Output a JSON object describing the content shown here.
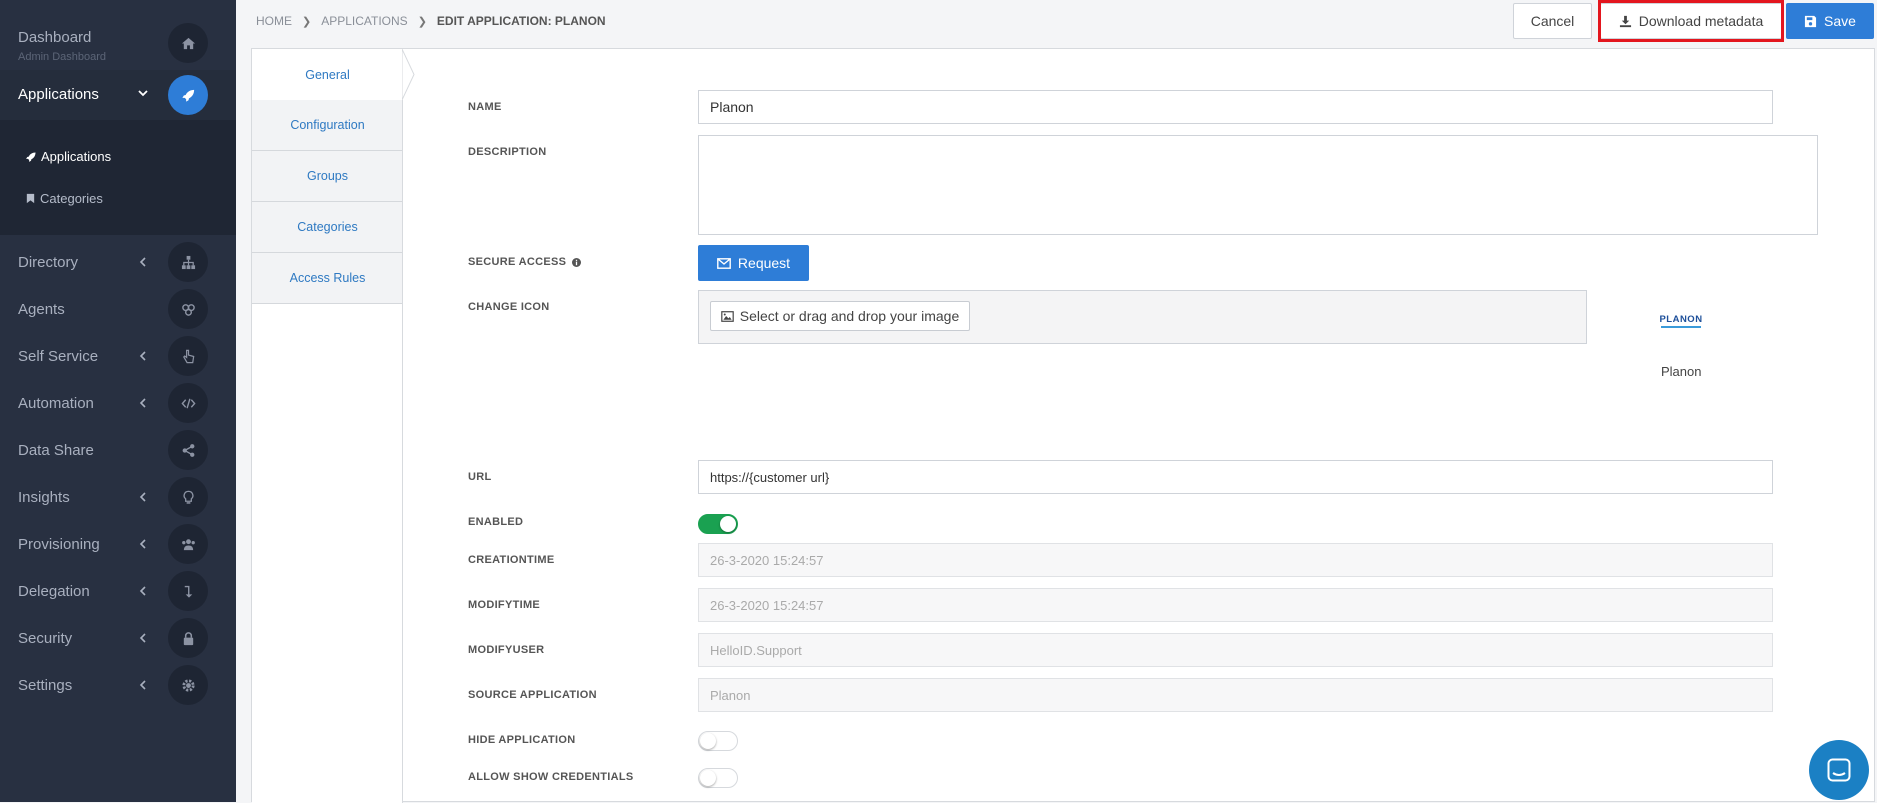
{
  "sidebar": {
    "dashboard": {
      "label": "Dashboard",
      "sub": "Admin Dashboard",
      "icon": "home-icon"
    },
    "applications": {
      "label": "Applications",
      "icon": "rocket-icon",
      "items": [
        {
          "label": "Applications",
          "icon": "rocket-icon"
        },
        {
          "label": "Categories",
          "icon": "bookmark-icon"
        }
      ]
    },
    "items": [
      {
        "label": "Directory",
        "chevron": true,
        "icon": "sitemap-icon"
      },
      {
        "label": "Agents",
        "chevron": false,
        "icon": "agents-icon"
      },
      {
        "label": "Self Service",
        "chevron": true,
        "icon": "hand-pointer-icon"
      },
      {
        "label": "Automation",
        "chevron": true,
        "icon": "code-icon"
      },
      {
        "label": "Data Share",
        "chevron": false,
        "icon": "share-icon"
      },
      {
        "label": "Insights",
        "chevron": true,
        "icon": "lightbulb-icon"
      },
      {
        "label": "Provisioning",
        "chevron": true,
        "icon": "users-icon"
      },
      {
        "label": "Delegation",
        "chevron": true,
        "icon": "delegation-icon"
      },
      {
        "label": "Security",
        "chevron": true,
        "icon": "lock-icon"
      },
      {
        "label": "Settings",
        "chevron": true,
        "icon": "gear-icon"
      }
    ]
  },
  "breadcrumb": [
    "HOME",
    "APPLICATIONS",
    "EDIT APPLICATION: PLANON"
  ],
  "buttons": {
    "cancel": "Cancel",
    "download": "Download metadata",
    "save": "Save",
    "request": "Request"
  },
  "tabs": [
    "General",
    "Configuration",
    "Groups",
    "Categories",
    "Access Rules"
  ],
  "form": {
    "name_label": "NAME",
    "name_value": "Planon",
    "description_label": "DESCRIPTION",
    "description_value": "",
    "secure_access_label": "SECURE ACCESS",
    "change_icon_label": "CHANGE ICON",
    "icon_picker": "Select or drag and drop your image",
    "icon_preview_name": "Planon",
    "logo_text": "PLANON",
    "url_label": "URL",
    "url_value": "https://{customer url}",
    "enabled_label": "ENABLED",
    "enabled": true,
    "creationtime_label": "CREATIONTIME",
    "creationtime_value": "26-3-2020 15:24:57",
    "modifytime_label": "MODIFYTIME",
    "modifytime_value": "26-3-2020 15:24:57",
    "modifyuser_label": "MODIFYUSER",
    "modifyuser_value": "HelloID.Support",
    "source_label": "SOURCE APPLICATION",
    "source_value": "Planon",
    "hide_label": "HIDE APPLICATION",
    "hide": false,
    "allow_label": "ALLOW SHOW CREDENTIALS",
    "allow": false
  },
  "colors": {
    "accent": "#2e7dd7",
    "sidebar": "#283041",
    "enabled": "#1aa151",
    "highlight": "#e3161e"
  }
}
